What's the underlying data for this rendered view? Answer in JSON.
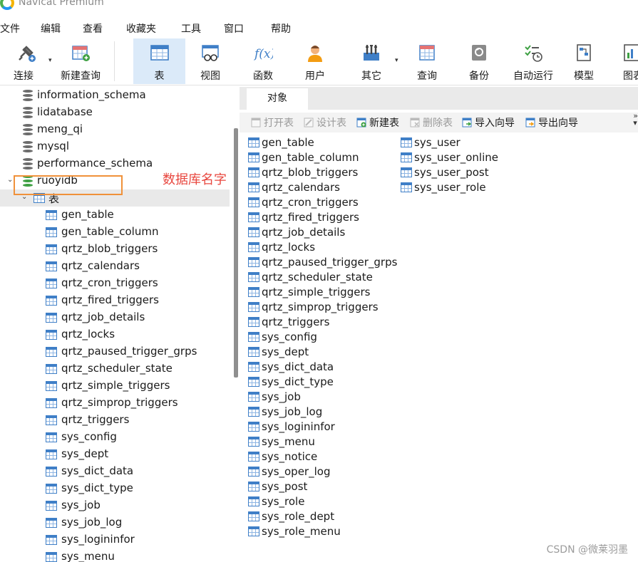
{
  "window": {
    "title": "Navicat Premium"
  },
  "menu": [
    "文件",
    "编辑",
    "查看",
    "收藏夹",
    "工具",
    "窗口",
    "帮助"
  ],
  "toolbar": [
    {
      "name": "connect",
      "label": "连接",
      "icon": "plug-icon",
      "dropdown": true
    },
    {
      "name": "new-query",
      "label": "新建查询",
      "icon": "new-query-icon",
      "dropdown": false
    },
    {
      "name": "table",
      "label": "表",
      "icon": "table-icon",
      "active": true
    },
    {
      "name": "view",
      "label": "视图",
      "icon": "view-icon"
    },
    {
      "name": "function",
      "label": "函数",
      "icon": "function-icon"
    },
    {
      "name": "user",
      "label": "用户",
      "icon": "user-icon"
    },
    {
      "name": "other",
      "label": "其它",
      "icon": "tools-icon",
      "dropdown": true
    },
    {
      "name": "query",
      "label": "查询",
      "icon": "query-icon"
    },
    {
      "name": "backup",
      "label": "备份",
      "icon": "backup-icon"
    },
    {
      "name": "auto-run",
      "label": "自动运行",
      "icon": "schedule-icon"
    },
    {
      "name": "model",
      "label": "模型",
      "icon": "model-icon"
    },
    {
      "name": "chart",
      "label": "图表",
      "icon": "chart-icon"
    }
  ],
  "tree": {
    "databases": [
      "information_schema",
      "lidatabase",
      "meng_qi",
      "mysql",
      "performance_schema"
    ],
    "open_database": "ruoyidb",
    "tables_node": "表",
    "tables": [
      "gen_table",
      "gen_table_column",
      "qrtz_blob_triggers",
      "qrtz_calendars",
      "qrtz_cron_triggers",
      "qrtz_fired_triggers",
      "qrtz_job_details",
      "qrtz_locks",
      "qrtz_paused_trigger_grps",
      "qrtz_scheduler_state",
      "qrtz_simple_triggers",
      "qrtz_simprop_triggers",
      "qrtz_triggers",
      "sys_config",
      "sys_dept",
      "sys_dict_data",
      "sys_dict_type",
      "sys_job",
      "sys_job_log",
      "sys_logininfor",
      "sys_menu"
    ]
  },
  "annotation": {
    "text": "数据库名字",
    "color": "#e8473f"
  },
  "objects_tab": {
    "label": "对象"
  },
  "object_toolbar": [
    {
      "name": "open-table",
      "label": "打开表",
      "enabled": false,
      "icon": "open-table-icon"
    },
    {
      "name": "design-table",
      "label": "设计表",
      "enabled": false,
      "icon": "design-table-icon"
    },
    {
      "name": "new-table",
      "label": "新建表",
      "enabled": true,
      "icon": "new-table-icon"
    },
    {
      "name": "delete-table",
      "label": "删除表",
      "enabled": false,
      "icon": "delete-table-icon"
    },
    {
      "name": "import-wizard",
      "label": "导入向导",
      "enabled": true,
      "icon": "import-icon"
    },
    {
      "name": "export-wizard",
      "label": "导出向导",
      "enabled": true,
      "icon": "export-icon"
    }
  ],
  "objects": {
    "column1": [
      "gen_table",
      "gen_table_column",
      "qrtz_blob_triggers",
      "qrtz_calendars",
      "qrtz_cron_triggers",
      "qrtz_fired_triggers",
      "qrtz_job_details",
      "qrtz_locks",
      "qrtz_paused_trigger_grps",
      "qrtz_scheduler_state",
      "qrtz_simple_triggers",
      "qrtz_simprop_triggers",
      "qrtz_triggers",
      "sys_config",
      "sys_dept",
      "sys_dict_data",
      "sys_dict_type",
      "sys_job",
      "sys_job_log",
      "sys_logininfor",
      "sys_menu",
      "sys_notice",
      "sys_oper_log",
      "sys_post",
      "sys_role",
      "sys_role_dept",
      "sys_role_menu"
    ],
    "column2": [
      "sys_user",
      "sys_user_online",
      "sys_user_post",
      "sys_user_role"
    ]
  },
  "watermark": "CSDN @微莱羽墨",
  "colors": {
    "accent": "#3f7fc7",
    "active_tab": "#dbeaf9",
    "highlight_box": "#f0913a",
    "db_open": "#3ea043"
  }
}
